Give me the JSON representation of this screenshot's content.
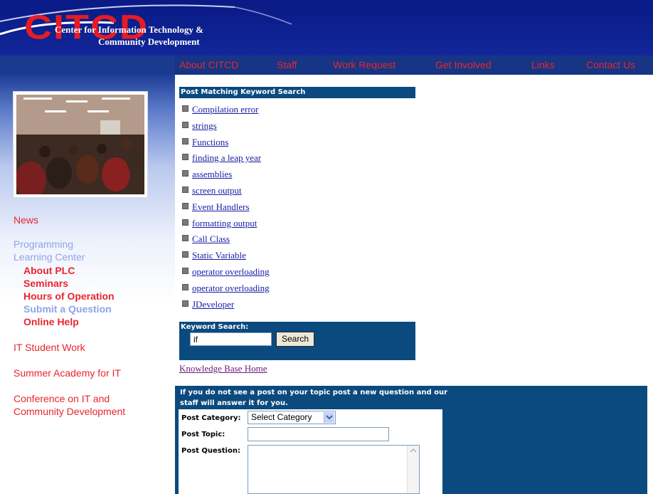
{
  "header": {
    "logo_big": "CITCD",
    "logo_line1": "Center for Information Technology &",
    "logo_line2": "Community Development"
  },
  "nav": {
    "items": [
      {
        "label": "About CITCD"
      },
      {
        "label": "Staff"
      },
      {
        "label": "Work Request"
      },
      {
        "label": "Get Involved"
      },
      {
        "label": "Links"
      },
      {
        "label": "Contact Us"
      }
    ]
  },
  "sidebar": {
    "news": "News",
    "plc_line1": "Programming",
    "plc_line2": "Learning Center",
    "plc_items": [
      {
        "label": "About PLC"
      },
      {
        "label": "Seminars"
      },
      {
        "label": "Hours of Operation"
      },
      {
        "label": "Submit a Question"
      },
      {
        "label": "Online Help"
      }
    ],
    "it_student_work": "IT Student Work",
    "summer_academy": "Summer Academy for IT",
    "conference_line1": "Conference on IT and",
    "conference_line2": "Community Development"
  },
  "posts": {
    "header": "Post Matching Keyword Search",
    "items": [
      "Compilation error",
      "strings",
      "Functions",
      "finding a leap year",
      "assemblies",
      "screen output",
      "Event Handlers",
      "formatting output",
      "Call Class",
      "Static Variable",
      "operator overloading",
      "operator overloading",
      "JDeveloper"
    ]
  },
  "search": {
    "label": "Keyword Search:",
    "value": "if",
    "button": "Search"
  },
  "kb_home": "Knowledge Base Home",
  "new_post": {
    "intro_line1": "If you do not see a post on your topic post a new question and our",
    "intro_line2": "staff will answer it for you.",
    "category_label": "Post Category:",
    "category_value": "Select Category",
    "topic_label": "Post Topic:",
    "question_label": "Post Question:"
  },
  "colors": {
    "header_blue": "#0d2190",
    "nav_red": "#e8262e",
    "panel_blue": "#0b4a7e",
    "sidebar_link_red": "#e8262e",
    "sidebar_link_lavender": "#8fa4e6",
    "link_blue": "#1a1aa8",
    "visited_purple": "#6a1a7a"
  }
}
